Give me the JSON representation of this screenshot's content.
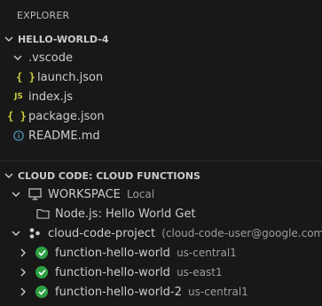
{
  "explorer": {
    "title": "EXPLORER"
  },
  "project": {
    "name": "HELLO-WORLD-4",
    "tree": [
      {
        "name": ".vscode",
        "kind": "folder"
      },
      {
        "name": "launch.json",
        "kind": "json"
      },
      {
        "name": "index.js",
        "kind": "js"
      },
      {
        "name": "package.json",
        "kind": "json"
      },
      {
        "name": "README.md",
        "kind": "info"
      }
    ]
  },
  "cloud": {
    "section_title": "CLOUD CODE: CLOUD FUNCTIONS",
    "workspace": {
      "label": "WORKSPACE",
      "desc": "Local"
    },
    "workspace_item": "Node.js: Hello World Get",
    "project": {
      "label": "cloud-code-project",
      "desc": "(cloud-code-user@google.com)"
    },
    "functions": [
      {
        "name": "function-hello-world",
        "region": "us-central1"
      },
      {
        "name": "function-hello-world",
        "region": "us-east1"
      },
      {
        "name": "function-hello-world-2",
        "region": "us-central1"
      }
    ]
  },
  "colors": {
    "background": "#181818",
    "text": "#cccccc",
    "json_icon": "#cbcb41",
    "success": "#2ea043"
  }
}
